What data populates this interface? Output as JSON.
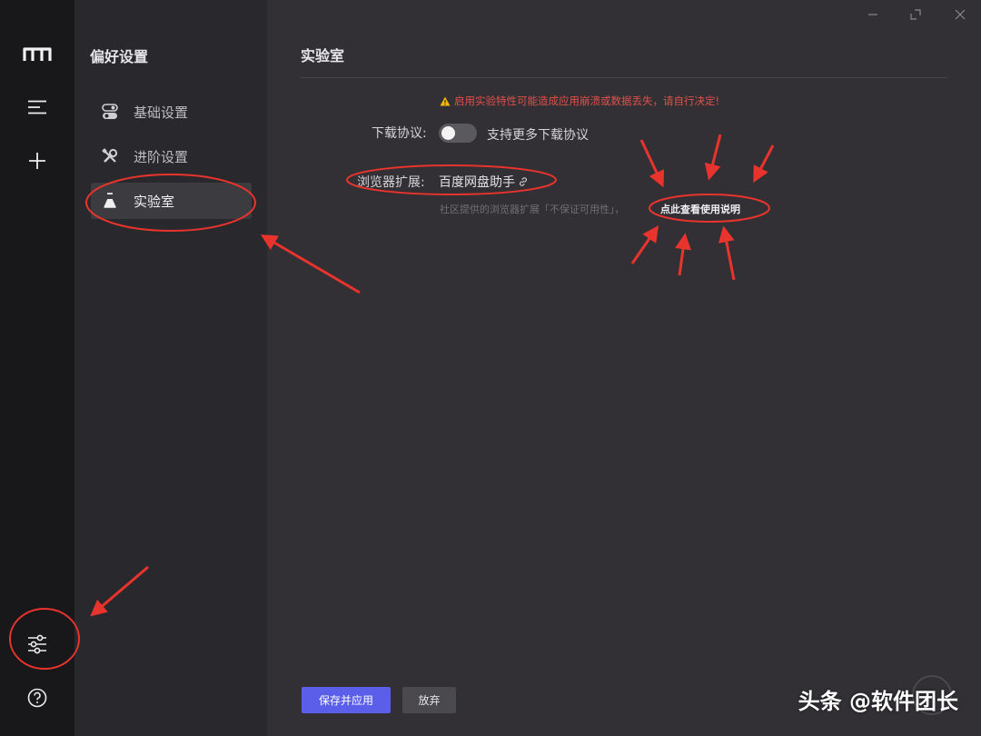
{
  "rail": {
    "icons": [
      "logo-icon",
      "menu-icon",
      "add-icon",
      "settings-sliders-icon",
      "help-icon"
    ]
  },
  "nav": {
    "title": "偏好设置",
    "items": [
      {
        "label": "基础设置",
        "icon": "toggle-settings-icon",
        "active": false
      },
      {
        "label": "进阶设置",
        "icon": "wrench-tools-icon",
        "active": false
      },
      {
        "label": "实验室",
        "icon": "flask-icon",
        "active": true
      }
    ]
  },
  "main": {
    "title": "实验室",
    "warning": "启用实验特性可能造成应用崩溃或数据丢失，请自行决定!",
    "download_protocol": {
      "label": "下载协议:",
      "toggle_on": false,
      "toggle_label": "支持更多下载协议"
    },
    "browser_extension": {
      "label": "浏览器扩展:",
      "link_text": "百度网盘助手",
      "note": "社区提供的浏览器扩展「不保证可用性」，",
      "help_text": "点此查看使用说明"
    },
    "buttons": {
      "save": "保存并应用",
      "discard": "放弃"
    }
  },
  "watermark": "头条 @软件团长",
  "colors": {
    "accent": "#5b5ee8",
    "warning": "#e0504a",
    "annotation": "#e8342c"
  }
}
